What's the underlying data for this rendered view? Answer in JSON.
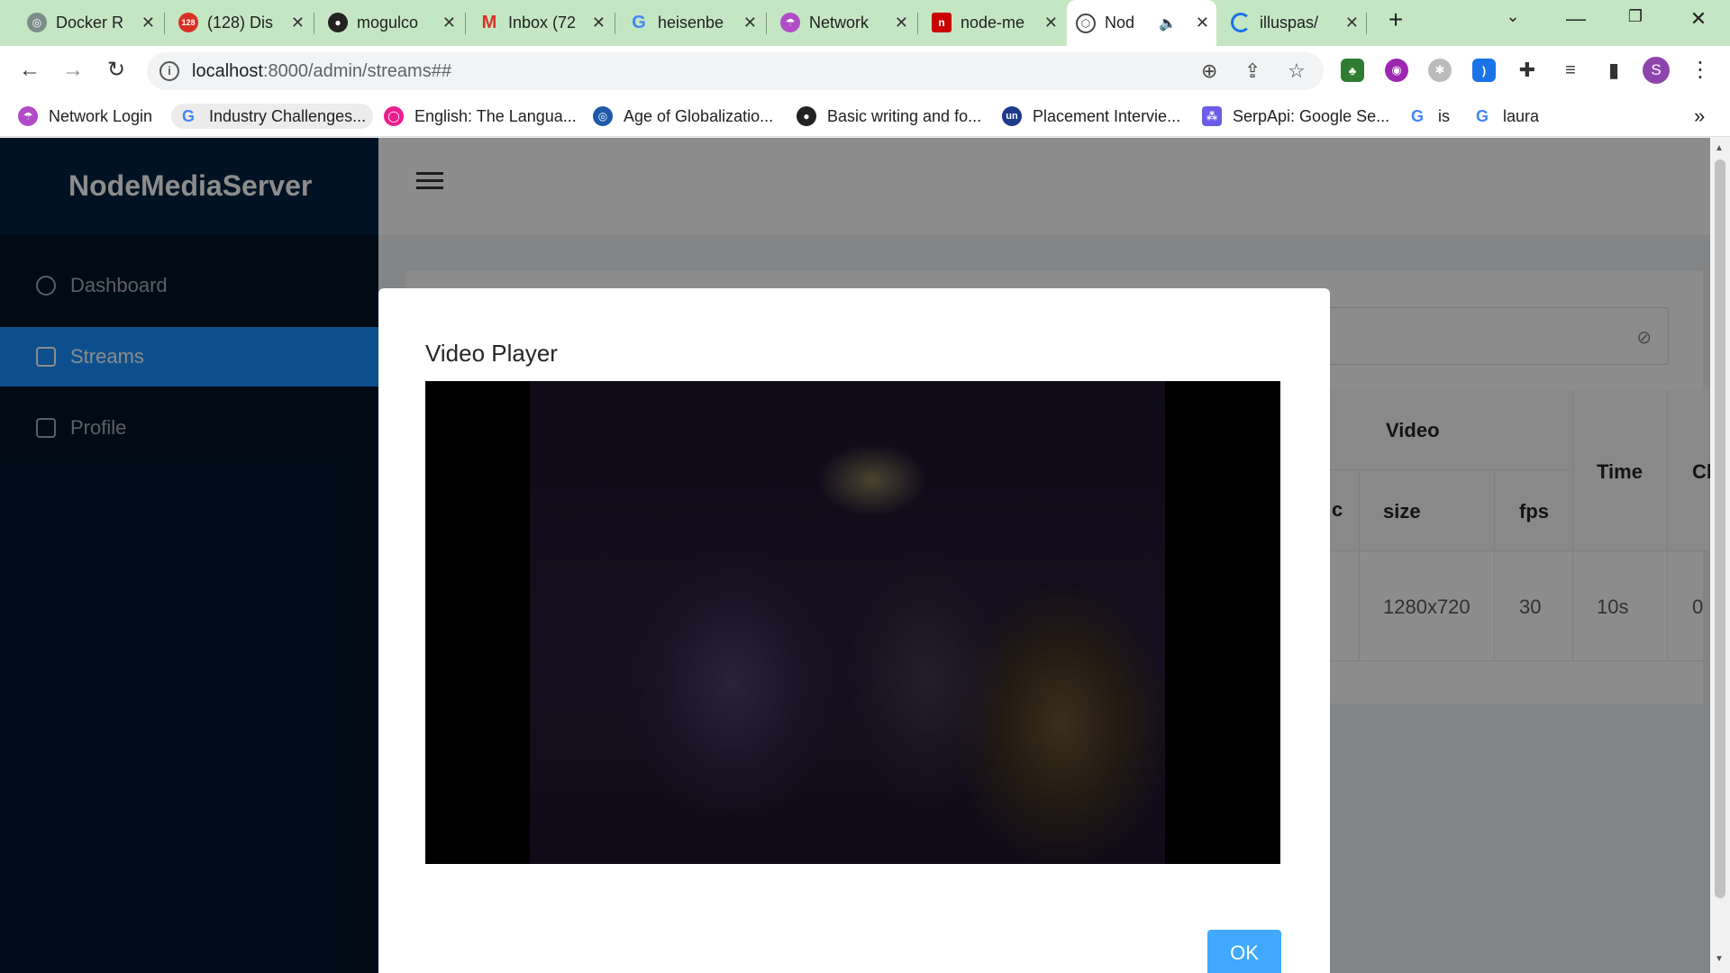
{
  "browser": {
    "tabs": [
      {
        "title": "Docker R",
        "icon": "openai-icon"
      },
      {
        "title": "(128) Dis",
        "icon": "discord-icon",
        "badge": "128"
      },
      {
        "title": "mogulco",
        "icon": "github-icon"
      },
      {
        "title": "Inbox (72",
        "icon": "gmail-icon"
      },
      {
        "title": "heisenbe",
        "icon": "google-icon"
      },
      {
        "title": "Network",
        "icon": "umbrella-icon"
      },
      {
        "title": "node-me",
        "icon": "npm-icon"
      },
      {
        "title": "Nod",
        "icon": "node-icon",
        "active": true
      },
      {
        "title": "illuspas/",
        "icon": "loading-icon"
      }
    ],
    "url_host": "localhost",
    "url_path": ":8000/admin/streams##",
    "profile_initial": "S",
    "bookmarks": [
      {
        "label": "Network Login"
      },
      {
        "label": "Industry Challenges..."
      },
      {
        "label": "English: The Langua..."
      },
      {
        "label": "Age of Globalizatio..."
      },
      {
        "label": "Basic writing and fo..."
      },
      {
        "label": "Placement Intervie..."
      },
      {
        "label": "SerpApi: Google Se..."
      },
      {
        "label": "is"
      },
      {
        "label": "laura"
      }
    ],
    "more_bookmarks": "»"
  },
  "app": {
    "brand": "NodeMediaServer",
    "menu": [
      {
        "label": "Dashboard",
        "icon": "dashboard-icon"
      },
      {
        "label": "Streams",
        "icon": "video-camera-icon",
        "selected": true
      },
      {
        "label": "Profile",
        "icon": "profile-icon"
      }
    ],
    "table": {
      "group_header": "Video",
      "headers": {
        "size": "size",
        "fps": "fps",
        "time": "Time",
        "clients": "Cl",
        "codec_tail": "c"
      },
      "row": {
        "size": "1280x720",
        "fps": "30",
        "time": "10s",
        "clients": "0"
      }
    }
  },
  "modal": {
    "title": "Video Player",
    "ok_label": "OK"
  }
}
